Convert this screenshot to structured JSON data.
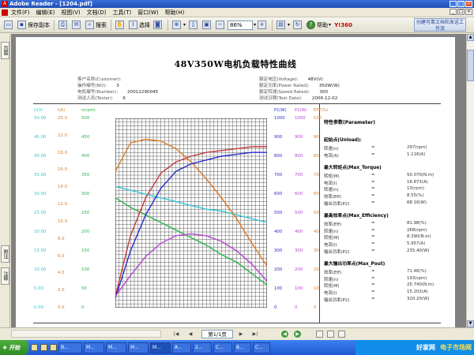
{
  "window": {
    "title": "Adobe Reader - [1204.pdf]",
    "app_icon": "adobe-reader-icon"
  },
  "menu": [
    "文件(F)",
    "编辑(E)",
    "视图(V)",
    "文档(D)",
    "工具(T)",
    "窗口(W)",
    "帮助(H)"
  ],
  "toolbar": {
    "save_copy": "保存副本",
    "search": "搜索",
    "select": "选择",
    "zoom": "86%",
    "help": "帮助",
    "create_pdf": "创建可靠文档和发送工作流",
    "brand": "Y!360"
  },
  "left_tabs": [
    "页面",
    "附注",
    "注释"
  ],
  "doc": {
    "title": "48V350W电机负载特性曲线",
    "info_left": [
      {
        "label": "客户名称(Customer):",
        "value": ""
      },
      {
        "label": "操作编号(NO):",
        "value": "3"
      },
      {
        "label": "电机编号(Number):",
        "value": "20012290045"
      },
      {
        "label": "测试人员(Tester):",
        "value": "6"
      }
    ],
    "info_right": [
      {
        "label": "额定电压(Voltage):",
        "value": "48V(V)"
      },
      {
        "label": "额定功率(Power Rated):",
        "value": "350W(W)"
      },
      {
        "label": "额定转速(Speed Rated):",
        "value": "300"
      },
      {
        "label": "测试日期(Test Date):",
        "value": "2006-12-02"
      }
    ]
  },
  "chart_data": {
    "type": "line",
    "left_axes": [
      {
        "name": "U(V)",
        "color": "#33c7d6",
        "ticks": [
          "50.00",
          "45.00",
          "40.00",
          "35.00",
          "30.00",
          "25.00",
          "20.00",
          "15.00",
          "10.00",
          "5.00",
          "0.00"
        ]
      },
      {
        "name": "I(A)",
        "color": "#e07a1f",
        "ticks": [
          "25.0",
          "22.0",
          "18.0",
          "16.0",
          "14.0",
          "12.0",
          "10.0",
          "8.0",
          "6.0",
          "4.0",
          "2.0",
          "0.0"
        ]
      },
      {
        "name": "n(rpm)",
        "color": "#2db34a",
        "ticks": [
          "500",
          "450",
          "400",
          "350",
          "300",
          "250",
          "200",
          "150",
          "100",
          "50",
          "0"
        ]
      }
    ],
    "right_axes": [
      {
        "name": "P1(W)",
        "color": "#2a2ad1",
        "ticks": [
          "1000",
          "900",
          "800",
          "700",
          "600",
          "500",
          "400",
          "300",
          "200",
          "100",
          "0"
        ]
      },
      {
        "name": "P2(W)",
        "color": "#b347d1",
        "ticks": [
          "1000",
          "900",
          "800",
          "700",
          "600",
          "500",
          "400",
          "300",
          "200",
          "100",
          "0"
        ]
      },
      {
        "name": "EFF(%)",
        "color": "#e07a1f",
        "ticks": [
          "100",
          "90",
          "80",
          "70",
          "60",
          "50",
          "40",
          "30",
          "20",
          "10",
          "0"
        ]
      }
    ],
    "x": [
      0,
      1,
      2,
      3,
      4,
      5,
      6,
      7,
      8,
      9,
      10
    ],
    "series": [
      {
        "color": "#2db34a",
        "values": [
          0.58,
          0.53,
          0.49,
          0.45,
          0.41,
          0.37,
          0.33,
          0.28,
          0.24,
          0.18,
          0.12
        ]
      },
      {
        "color": "#33c7d6",
        "values": [
          0.64,
          0.62,
          0.6,
          0.58,
          0.56,
          0.54,
          0.52,
          0.51,
          0.49,
          0.47,
          0.45
        ]
      },
      {
        "color": "#e07a1f",
        "values": [
          0.72,
          0.87,
          0.89,
          0.88,
          0.84,
          0.77,
          0.68,
          0.58,
          0.47,
          0.34,
          0.22
        ]
      },
      {
        "color": "#c43a3a",
        "values": [
          0.06,
          0.38,
          0.58,
          0.71,
          0.77,
          0.8,
          0.82,
          0.83,
          0.84,
          0.85,
          0.85
        ]
      },
      {
        "color": "#2a2ad1",
        "values": [
          0.05,
          0.3,
          0.49,
          0.63,
          0.72,
          0.76,
          0.78,
          0.8,
          0.81,
          0.82,
          0.82
        ]
      },
      {
        "color": "#b347d1",
        "values": [
          0.06,
          0.17,
          0.27,
          0.34,
          0.38,
          0.39,
          0.38,
          0.35,
          0.3,
          0.23,
          0.14
        ]
      }
    ],
    "grid": true
  },
  "params": {
    "title": "特性参数(Parameter)",
    "sections": [
      {
        "name": "起始点(Unload):",
        "rows": [
          {
            "k": "转速(n)",
            "v": "297(rpm)"
          },
          {
            "k": "电流(A)",
            "v": "1.116(A)"
          }
        ]
      },
      {
        "name": "最大转矩点(Max_Torque)",
        "rows": [
          {
            "k": "转矩(M)",
            "v": "50.070(N.m)"
          },
          {
            "k": "电流(I)",
            "v": "16.873(A)"
          },
          {
            "k": "转速(n)",
            "v": "13(rpm)"
          },
          {
            "k": "效率(Eff)",
            "v": "8.55(%)"
          },
          {
            "k": "输出功率(P2)",
            "v": "68.16(W)"
          }
        ]
      },
      {
        "name": "最高效率点(Max_Efficiency)",
        "rows": [
          {
            "k": "效率(Eff)",
            "v": "81.98(%)"
          },
          {
            "k": "转速(n)",
            "v": "268(rpm)"
          },
          {
            "k": "转矩(M)",
            "v": "8.390(N.m)"
          },
          {
            "k": "电流(I)",
            "v": "5.957(A)"
          },
          {
            "k": "输出功率(P2)",
            "v": "235.40(W)"
          }
        ]
      },
      {
        "name": "最大输出功率点(Max_Pout)",
        "rows": [
          {
            "k": "效率(Eff)",
            "v": "71.46(%)"
          },
          {
            "k": "转速(n)",
            "v": "193(rpm)"
          },
          {
            "k": "转矩(M)",
            "v": "25.740(N.m)"
          },
          {
            "k": "电流(I)",
            "v": "15.202(A)"
          },
          {
            "k": "输出功率(P2)",
            "v": "320.20(W)"
          }
        ]
      }
    ],
    "eq": "="
  },
  "pagenav": {
    "page": "第1/1页"
  },
  "taskbar": {
    "start": "开始",
    "tasks": [
      "B...",
      "M...",
      "M...",
      "M...",
      "M...",
      "A...",
      "2...",
      "C...",
      "8...",
      "C..."
    ],
    "watermark_left": "好家网",
    "watermark_right": "电子市场网"
  }
}
